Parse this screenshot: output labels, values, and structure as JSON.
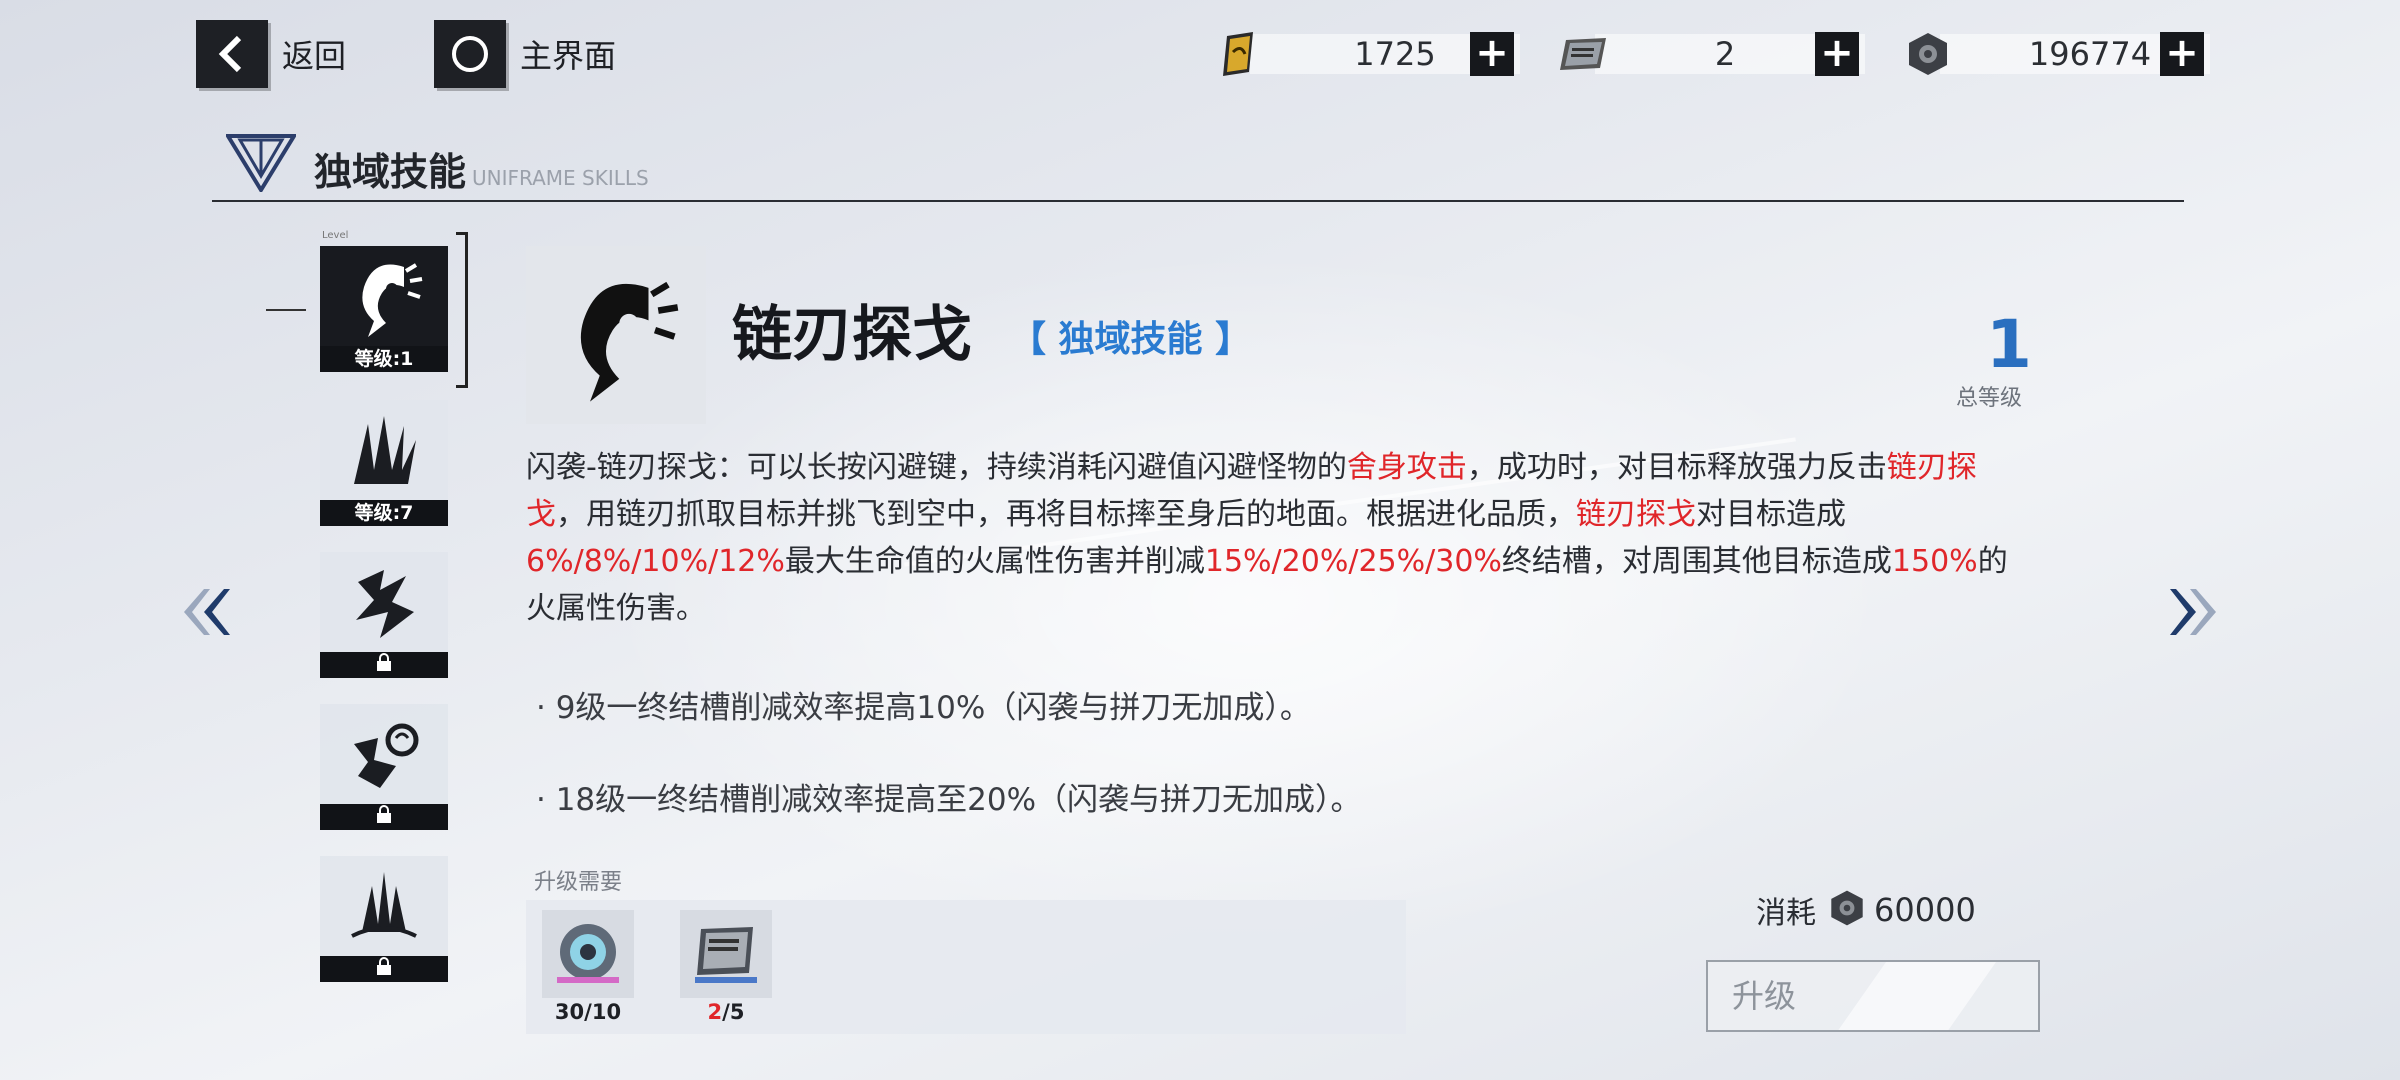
{
  "nav": {
    "back_label": "返回",
    "home_label": "主界面"
  },
  "resources": [
    {
      "icon": "gold-ticket-icon",
      "value": "1725"
    },
    {
      "icon": "supply-chip-icon",
      "value": "2"
    },
    {
      "icon": "hex-nut-coin-icon",
      "value": "196774"
    }
  ],
  "section": {
    "title": "独域技能",
    "subtitle": "UNIFRAME SKILLS"
  },
  "skill_list": {
    "level_caption": "Level",
    "items": [
      {
        "icon": "chain-blade-icon",
        "tag": "等级:1",
        "selected": true
      },
      {
        "icon": "spike-burst-icon",
        "tag": "等级:7"
      },
      {
        "icon": "lightning-claw-icon",
        "locked": true
      },
      {
        "icon": "dragon-fist-icon",
        "locked": true
      },
      {
        "icon": "ground-spikes-icon",
        "locked": true
      }
    ]
  },
  "skill": {
    "name": "链刃探戈",
    "type": "【 独域技能 】",
    "total_level": "1",
    "total_level_label": "总等级",
    "desc": [
      {
        "t": "闪袭-链刃探戈：可以长按闪避键，持续消耗闪避值闪避怪物的"
      },
      {
        "t": "舍身攻击",
        "red": true
      },
      {
        "t": "，成功时，对目标释放强力反击"
      },
      {
        "t": "链刃探戈",
        "red": true
      },
      {
        "t": "，用链刃抓取目标并挑飞到空中，再将目标摔至身后的地面。根据进化品质，"
      },
      {
        "t": "链刃探戈",
        "red": true
      },
      {
        "t": "对目标造成"
      },
      {
        "t": "6%/8%/10%/12%",
        "red": true
      },
      {
        "t": "最大生命值的火属性伤害并削减"
      },
      {
        "t": "15%/20%/25%/30%",
        "red": true
      },
      {
        "t": "终结槽，对周围其他目标造成"
      },
      {
        "t": "150%",
        "red": true
      },
      {
        "t": "的火属性伤害。"
      }
    ],
    "bonuses": [
      "· 9级一终结槽削减效率提高10%（闪袭与拼刀无加成）。",
      "· 18级一终结槽削减效率提高至20%（闪袭与拼刀无加成）。"
    ]
  },
  "upgrade": {
    "requirements_label": "升级需要",
    "items": [
      {
        "icon": "core-gear-icon",
        "owned": "30",
        "required": "10",
        "insufficient": false
      },
      {
        "icon": "supply-chip-icon",
        "owned": "2",
        "required": "5",
        "insufficient": true
      }
    ],
    "cost_label": "消耗",
    "cost_value": "60000",
    "button_label": "升级"
  },
  "colors": {
    "accent_blue": "#2a7bd1",
    "highlight_red": "#e0262a",
    "dark": "#16181c"
  }
}
